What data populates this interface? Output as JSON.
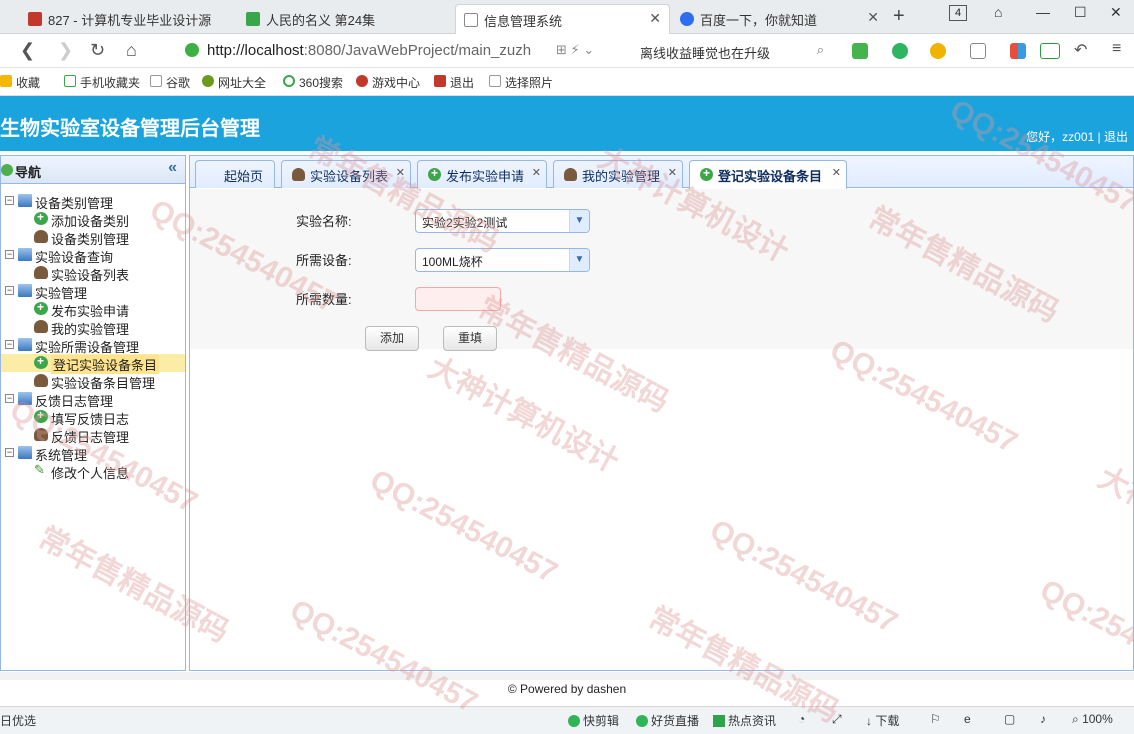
{
  "browser": {
    "tabs": [
      {
        "title": "827 - 计算机专业毕业设计源",
        "active": false
      },
      {
        "title": "人民的名义 第24集",
        "active": false
      },
      {
        "title": "信息管理系统",
        "active": true
      },
      {
        "title": "百度一下，你就知道",
        "active": false
      }
    ],
    "tab_count": "4",
    "url_host": "http://localhost",
    "url_rest": ":8080/JavaWebProject/main_zuzh",
    "search_text": "离线收益睡觉也在升级",
    "bookmarks": [
      "收藏",
      "手机收藏夹",
      "谷歌",
      "网址大全",
      "360搜索",
      "游戏中心",
      "退出",
      "选择照片"
    ]
  },
  "app": {
    "title": "生物实验室设备管理后台管理",
    "greeting": "您好，zz001 | ",
    "logout": "退出"
  },
  "sidebar": {
    "title": "导航",
    "tree": [
      {
        "label": "设备类别管理",
        "level": 0,
        "icon": "pc-icon"
      },
      {
        "label": "添加设备类别",
        "level": 1,
        "icon": "add-icon"
      },
      {
        "label": "设备类别管理",
        "level": 1,
        "icon": "user-icon"
      },
      {
        "label": "实验设备查询",
        "level": 0,
        "icon": "pc-icon"
      },
      {
        "label": "实验设备列表",
        "level": 1,
        "icon": "user-icon"
      },
      {
        "label": "实验管理",
        "level": 0,
        "icon": "pc-icon"
      },
      {
        "label": "发布实验申请",
        "level": 1,
        "icon": "add-icon"
      },
      {
        "label": "我的实验管理",
        "level": 1,
        "icon": "user-icon"
      },
      {
        "label": "实验所需设备管理",
        "level": 0,
        "icon": "pc-icon"
      },
      {
        "label": "登记实验设备条目",
        "level": 1,
        "icon": "add-icon",
        "selected": true
      },
      {
        "label": "实验设备条目管理",
        "level": 1,
        "icon": "user-icon"
      },
      {
        "label": "反馈日志管理",
        "level": 0,
        "icon": "pc-icon"
      },
      {
        "label": "填写反馈日志",
        "level": 1,
        "icon": "add-icon"
      },
      {
        "label": "反馈日志管理",
        "level": 1,
        "icon": "user-icon"
      },
      {
        "label": "系统管理",
        "level": 0,
        "icon": "pc-icon"
      },
      {
        "label": "修改个人信息",
        "level": 1,
        "icon": "pencil-icon"
      }
    ]
  },
  "panel_tabs": [
    {
      "label": "起始页",
      "icon": "",
      "closable": false
    },
    {
      "label": "实验设备列表",
      "icon": "user-icon",
      "closable": true
    },
    {
      "label": "发布实验申请",
      "icon": "add-icon",
      "closable": true
    },
    {
      "label": "我的实验管理",
      "icon": "user-icon",
      "closable": true
    },
    {
      "label": "登记实验设备条目",
      "icon": "add-icon",
      "closable": true,
      "active": true
    }
  ],
  "form": {
    "experiment_label": "实验名称:",
    "experiment_value": "实验2实验2测试",
    "equipment_label": "所需设备:",
    "equipment_value": "100ML烧杯",
    "quantity_label": "所需数量:",
    "quantity_value": "",
    "add_button": "添加",
    "reset_button": "重填"
  },
  "footer": "© Powered by dashen",
  "statusbar": {
    "left": "日优选",
    "items": [
      "快剪辑",
      "好货直播",
      "热点资讯",
      "下载"
    ],
    "zoom": "100%"
  },
  "watermarks": [
    "QQ:254540457",
    "常年售精品源码",
    "大神计算机设计"
  ],
  "colors": {
    "header": "#1aa3dd",
    "border": "#95b8e7",
    "selected": "#fbeca6"
  }
}
